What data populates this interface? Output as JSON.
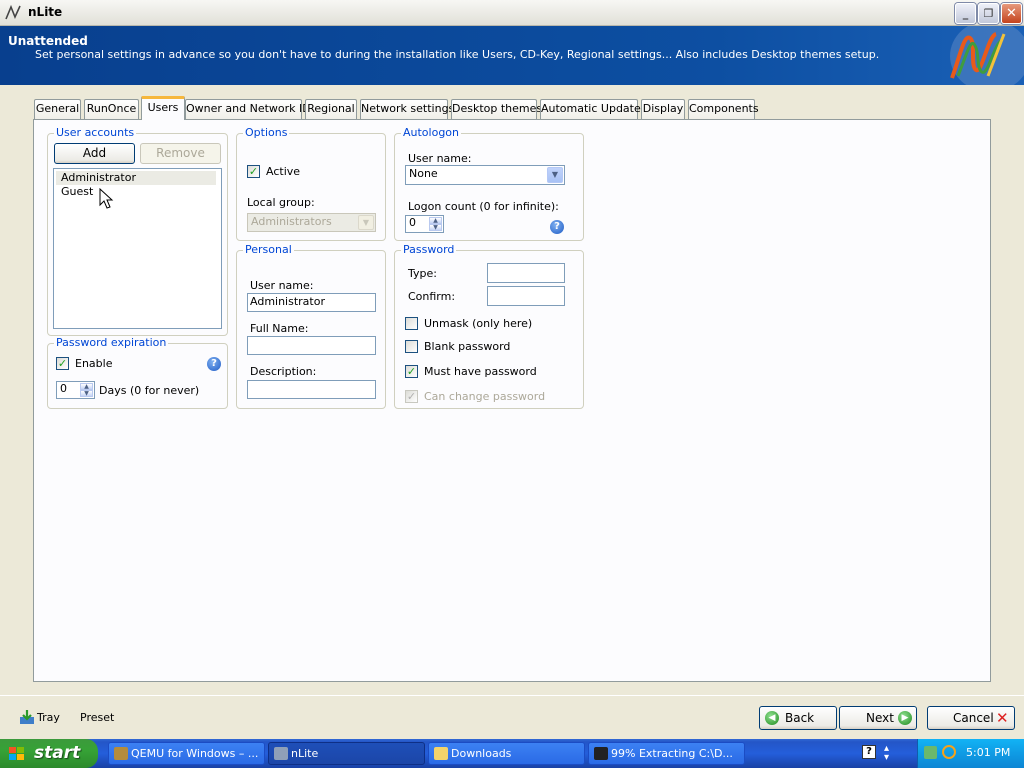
{
  "window": {
    "title": "nLite",
    "buttons": {
      "minimize": "_",
      "maximize": "❐",
      "close": "✕"
    }
  },
  "header": {
    "title": "Unattended",
    "description": "Set personal settings in advance so you don't have to during the installation like Users, CD-Key, Regional settings... Also includes Desktop themes setup."
  },
  "tabs": [
    {
      "label": "General"
    },
    {
      "label": "RunOnce"
    },
    {
      "label": "Users",
      "active": true
    },
    {
      "label": "Owner and Network ID"
    },
    {
      "label": "Regional"
    },
    {
      "label": "Network settings"
    },
    {
      "label": "Desktop themes"
    },
    {
      "label": "Automatic Updates"
    },
    {
      "label": "Display"
    },
    {
      "label": "Components"
    }
  ],
  "user_accounts": {
    "title": "User accounts",
    "add_label": "Add",
    "remove_label": "Remove",
    "items": [
      "Administrator",
      "Guest"
    ],
    "selected": "Administrator"
  },
  "password_expiration": {
    "title": "Password expiration",
    "enable_label": "Enable",
    "enable_checked": true,
    "days_value": "0",
    "days_label": "Days (0 for never)"
  },
  "options": {
    "title": "Options",
    "active_label": "Active",
    "active_checked": true,
    "local_group_label": "Local group:",
    "local_group_value": "Administrators"
  },
  "personal": {
    "title": "Personal",
    "user_name_label": "User name:",
    "user_name_value": "Administrator",
    "full_name_label": "Full Name:",
    "full_name_value": "",
    "description_label": "Description:",
    "description_value": ""
  },
  "autologon": {
    "title": "Autologon",
    "user_name_label": "User name:",
    "user_name_value": "None",
    "logon_count_label": "Logon count (0 for infinite):",
    "logon_count_value": "0"
  },
  "password": {
    "title": "Password",
    "type_label": "Type:",
    "confirm_label": "Confirm:",
    "unmask_label": "Unmask (only here)",
    "unmask_checked": false,
    "blank_label": "Blank password",
    "blank_checked": false,
    "must_have_label": "Must have password",
    "must_have_checked": true,
    "can_change_label": "Can change password",
    "can_change_checked": true
  },
  "bottom": {
    "tray_label": "Tray",
    "preset_label": "Preset",
    "back_label": "Back",
    "next_label": "Next",
    "cancel_label": "Cancel"
  },
  "taskbar": {
    "start_label": "start",
    "tasks": [
      {
        "label": "QEMU for Windows – ..."
      },
      {
        "label": "nLite",
        "active": true
      },
      {
        "label": "Downloads"
      },
      {
        "label": "99% Extracting C:\\D..."
      }
    ],
    "clock": "5:01 PM"
  },
  "colors": {
    "header_bg": "#0d4fa2",
    "group_title": "#0046d5",
    "tab_active_accent": "#f6b73c",
    "taskbar": "#245edb",
    "start_button": "#36a236"
  }
}
